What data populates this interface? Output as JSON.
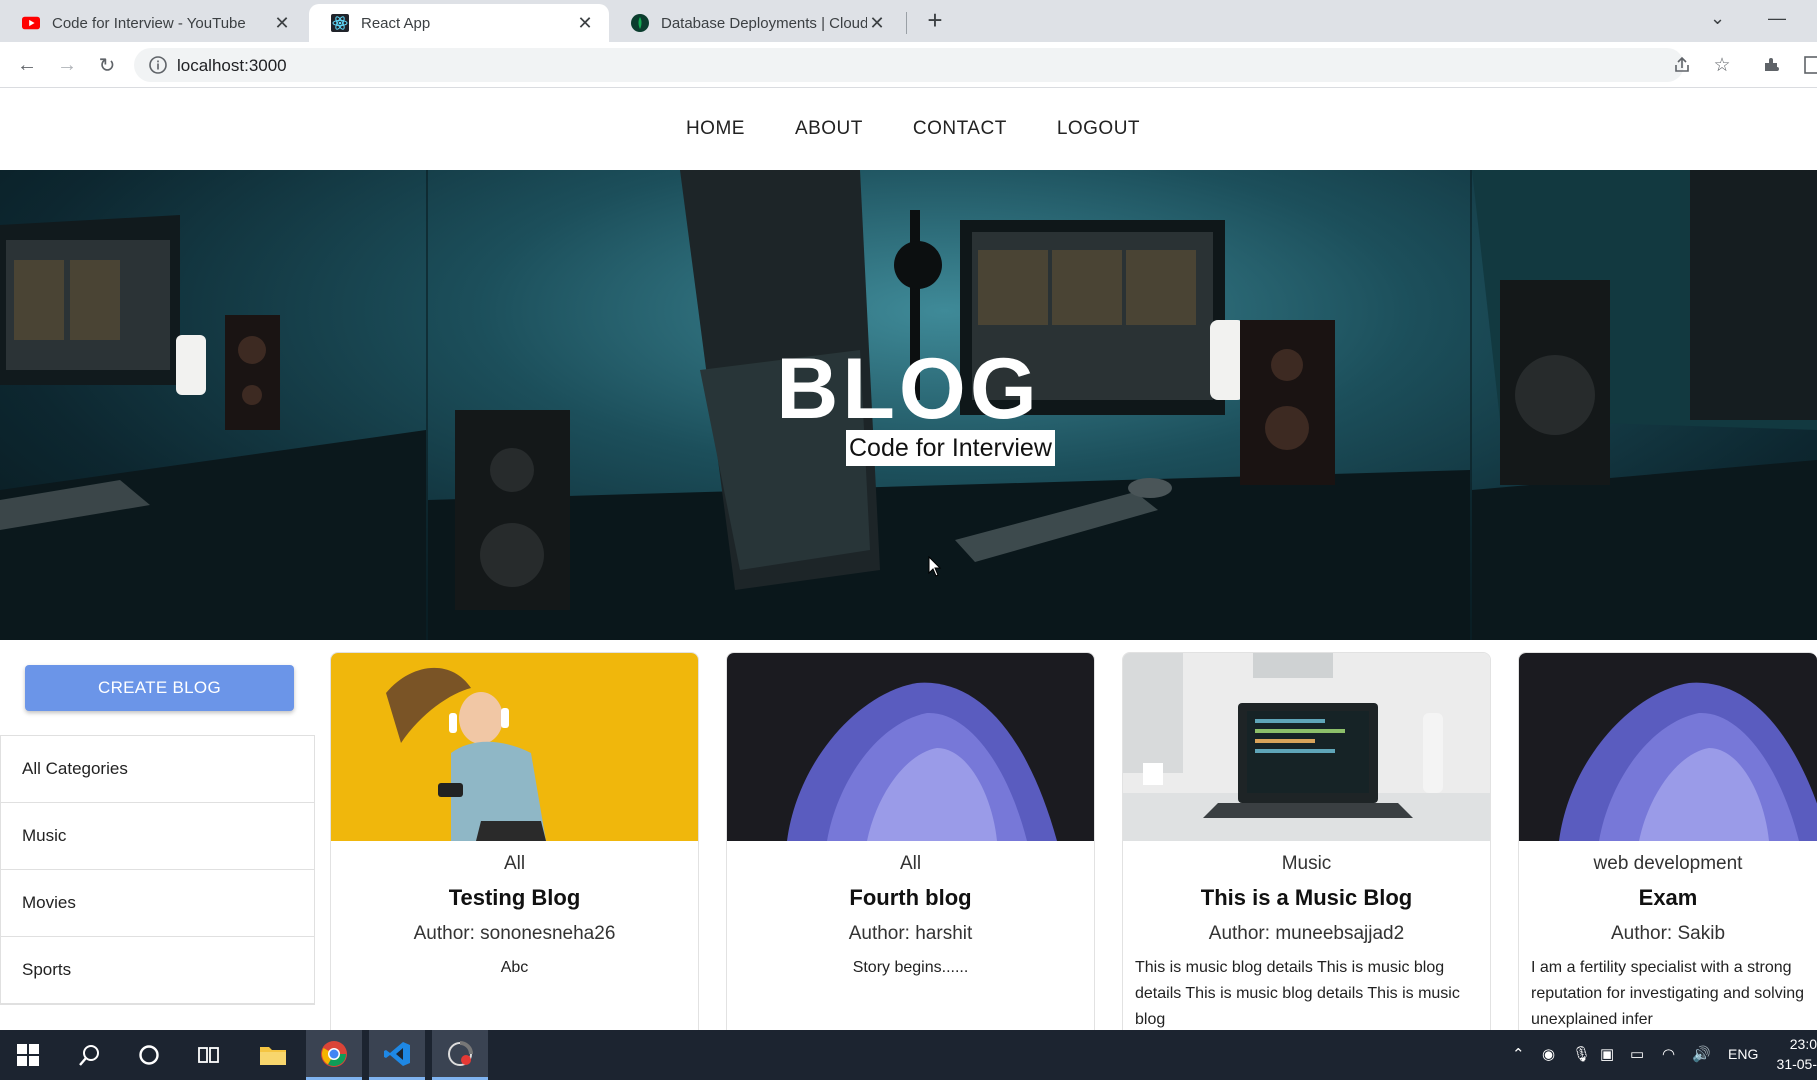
{
  "browser": {
    "tabs": [
      {
        "title": "Code for Interview - YouTube",
        "active": false
      },
      {
        "title": "React App",
        "active": true
      },
      {
        "title": "Database Deployments | Cloud: M",
        "active": false
      }
    ],
    "url": "localhost:3000"
  },
  "site_nav": {
    "items": [
      "HOME",
      "ABOUT",
      "CONTACT",
      "LOGOUT"
    ]
  },
  "hero": {
    "title": "BLOG",
    "subtitle": "Code for Interview"
  },
  "sidebar": {
    "create_label": "CREATE BLOG",
    "categories": [
      "All Categories",
      "Music",
      "Movies",
      "Sports"
    ]
  },
  "posts": [
    {
      "category": "All",
      "title": "Testing Blog",
      "author": "Author: sononesneha26",
      "description": "Abc"
    },
    {
      "category": "All",
      "title": "Fourth blog",
      "author": "Author: harshit",
      "description": "Story begins......"
    },
    {
      "category": "Music",
      "title": "This is a Music Blog",
      "author": "Author: muneebsajjad2",
      "description": "This is music blog details This is music blog details This is music blog details This is music blog"
    },
    {
      "category": "web development",
      "title": "Exam",
      "author": "Author: Sakib",
      "description": "I am a fertility specialist with a strong reputation for investigating and solving unexplained infer"
    }
  ],
  "taskbar": {
    "language": "ENG",
    "time": "23:0",
    "date": "31-05-"
  },
  "colors": {
    "primary_button": "#6b95e8",
    "tabbar": "#dee1e6",
    "taskbar": "#1c2430"
  }
}
